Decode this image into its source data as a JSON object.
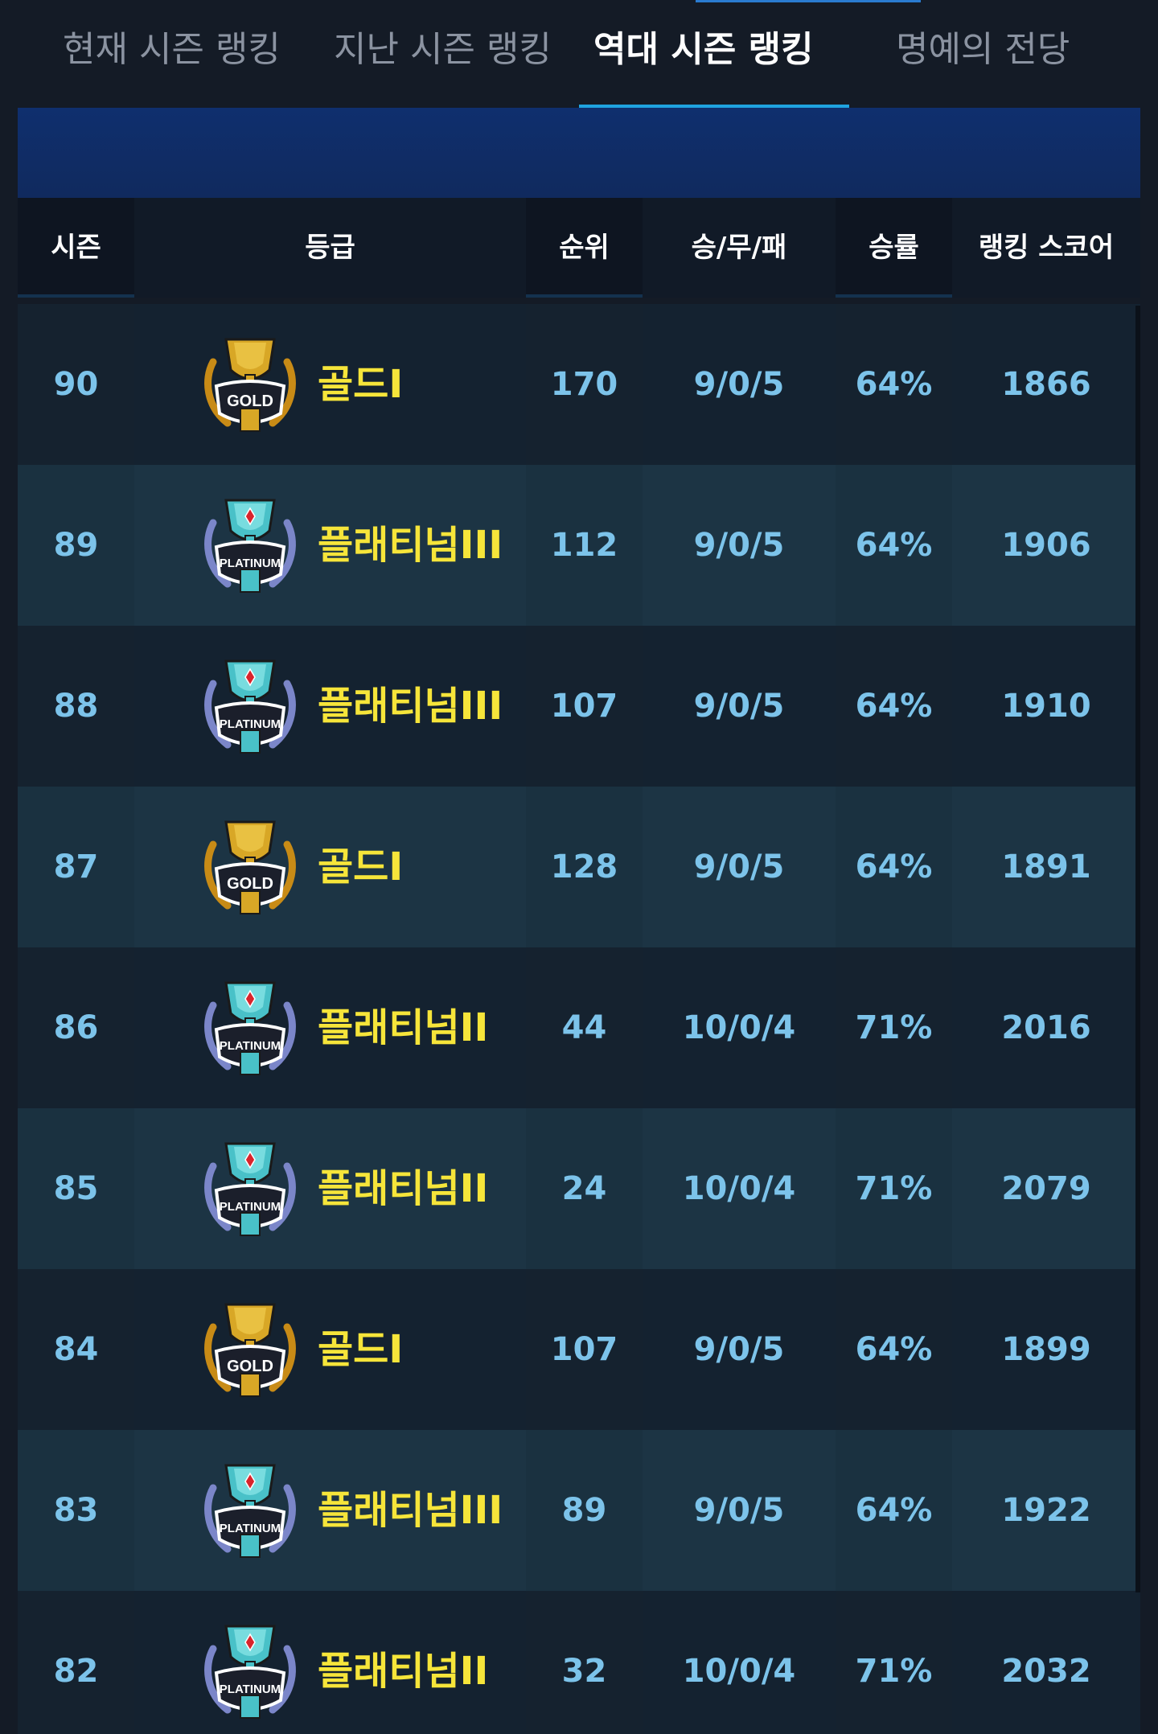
{
  "tabs": [
    {
      "label": "현재 시즌 랭킹"
    },
    {
      "label": "지난 시즌 랭킹"
    },
    {
      "label": "역대 시즌 랭킹"
    },
    {
      "label": "명예의 전당"
    }
  ],
  "table": {
    "headers": {
      "season": "시즌",
      "grade": "등급",
      "rank": "순위",
      "record": "승/무/패",
      "winrate": "승률",
      "score": "랭킹 스코어"
    },
    "rows": [
      {
        "season": "90",
        "tier": "gold",
        "emblem_label": "GOLD",
        "grade": "골드I",
        "rank": "170",
        "record": "9/0/5",
        "winrate": "64%",
        "score": "1866"
      },
      {
        "season": "89",
        "tier": "platinum",
        "emblem_label": "PLATINUM",
        "grade": "플래티넘III",
        "rank": "112",
        "record": "9/0/5",
        "winrate": "64%",
        "score": "1906"
      },
      {
        "season": "88",
        "tier": "platinum",
        "emblem_label": "PLATINUM",
        "grade": "플래티넘III",
        "rank": "107",
        "record": "9/0/5",
        "winrate": "64%",
        "score": "1910"
      },
      {
        "season": "87",
        "tier": "gold",
        "emblem_label": "GOLD",
        "grade": "골드I",
        "rank": "128",
        "record": "9/0/5",
        "winrate": "64%",
        "score": "1891"
      },
      {
        "season": "86",
        "tier": "platinum",
        "emblem_label": "PLATINUM",
        "grade": "플래티넘II",
        "rank": "44",
        "record": "10/0/4",
        "winrate": "71%",
        "score": "2016"
      },
      {
        "season": "85",
        "tier": "platinum",
        "emblem_label": "PLATINUM",
        "grade": "플래티넘II",
        "rank": "24",
        "record": "10/0/4",
        "winrate": "71%",
        "score": "2079"
      },
      {
        "season": "84",
        "tier": "gold",
        "emblem_label": "GOLD",
        "grade": "골드I",
        "rank": "107",
        "record": "9/0/5",
        "winrate": "64%",
        "score": "1899"
      },
      {
        "season": "83",
        "tier": "platinum",
        "emblem_label": "PLATINUM",
        "grade": "플래티넘III",
        "rank": "89",
        "record": "9/0/5",
        "winrate": "64%",
        "score": "1922"
      },
      {
        "season": "82",
        "tier": "platinum",
        "emblem_label": "PLATINUM",
        "grade": "플래티넘II",
        "rank": "32",
        "record": "10/0/4",
        "winrate": "71%",
        "score": "2032"
      }
    ]
  },
  "colors": {
    "accent": "#1fa3e0",
    "value_text": "#7cc3ea",
    "grade_text": "#f6e53a",
    "banner": "#0f2f6e",
    "gold_emblem": "#d4a62a",
    "platinum_emblem": "#4fc3c9"
  },
  "icons": {
    "gold": "gold-emblem-icon",
    "platinum": "platinum-emblem-icon"
  }
}
